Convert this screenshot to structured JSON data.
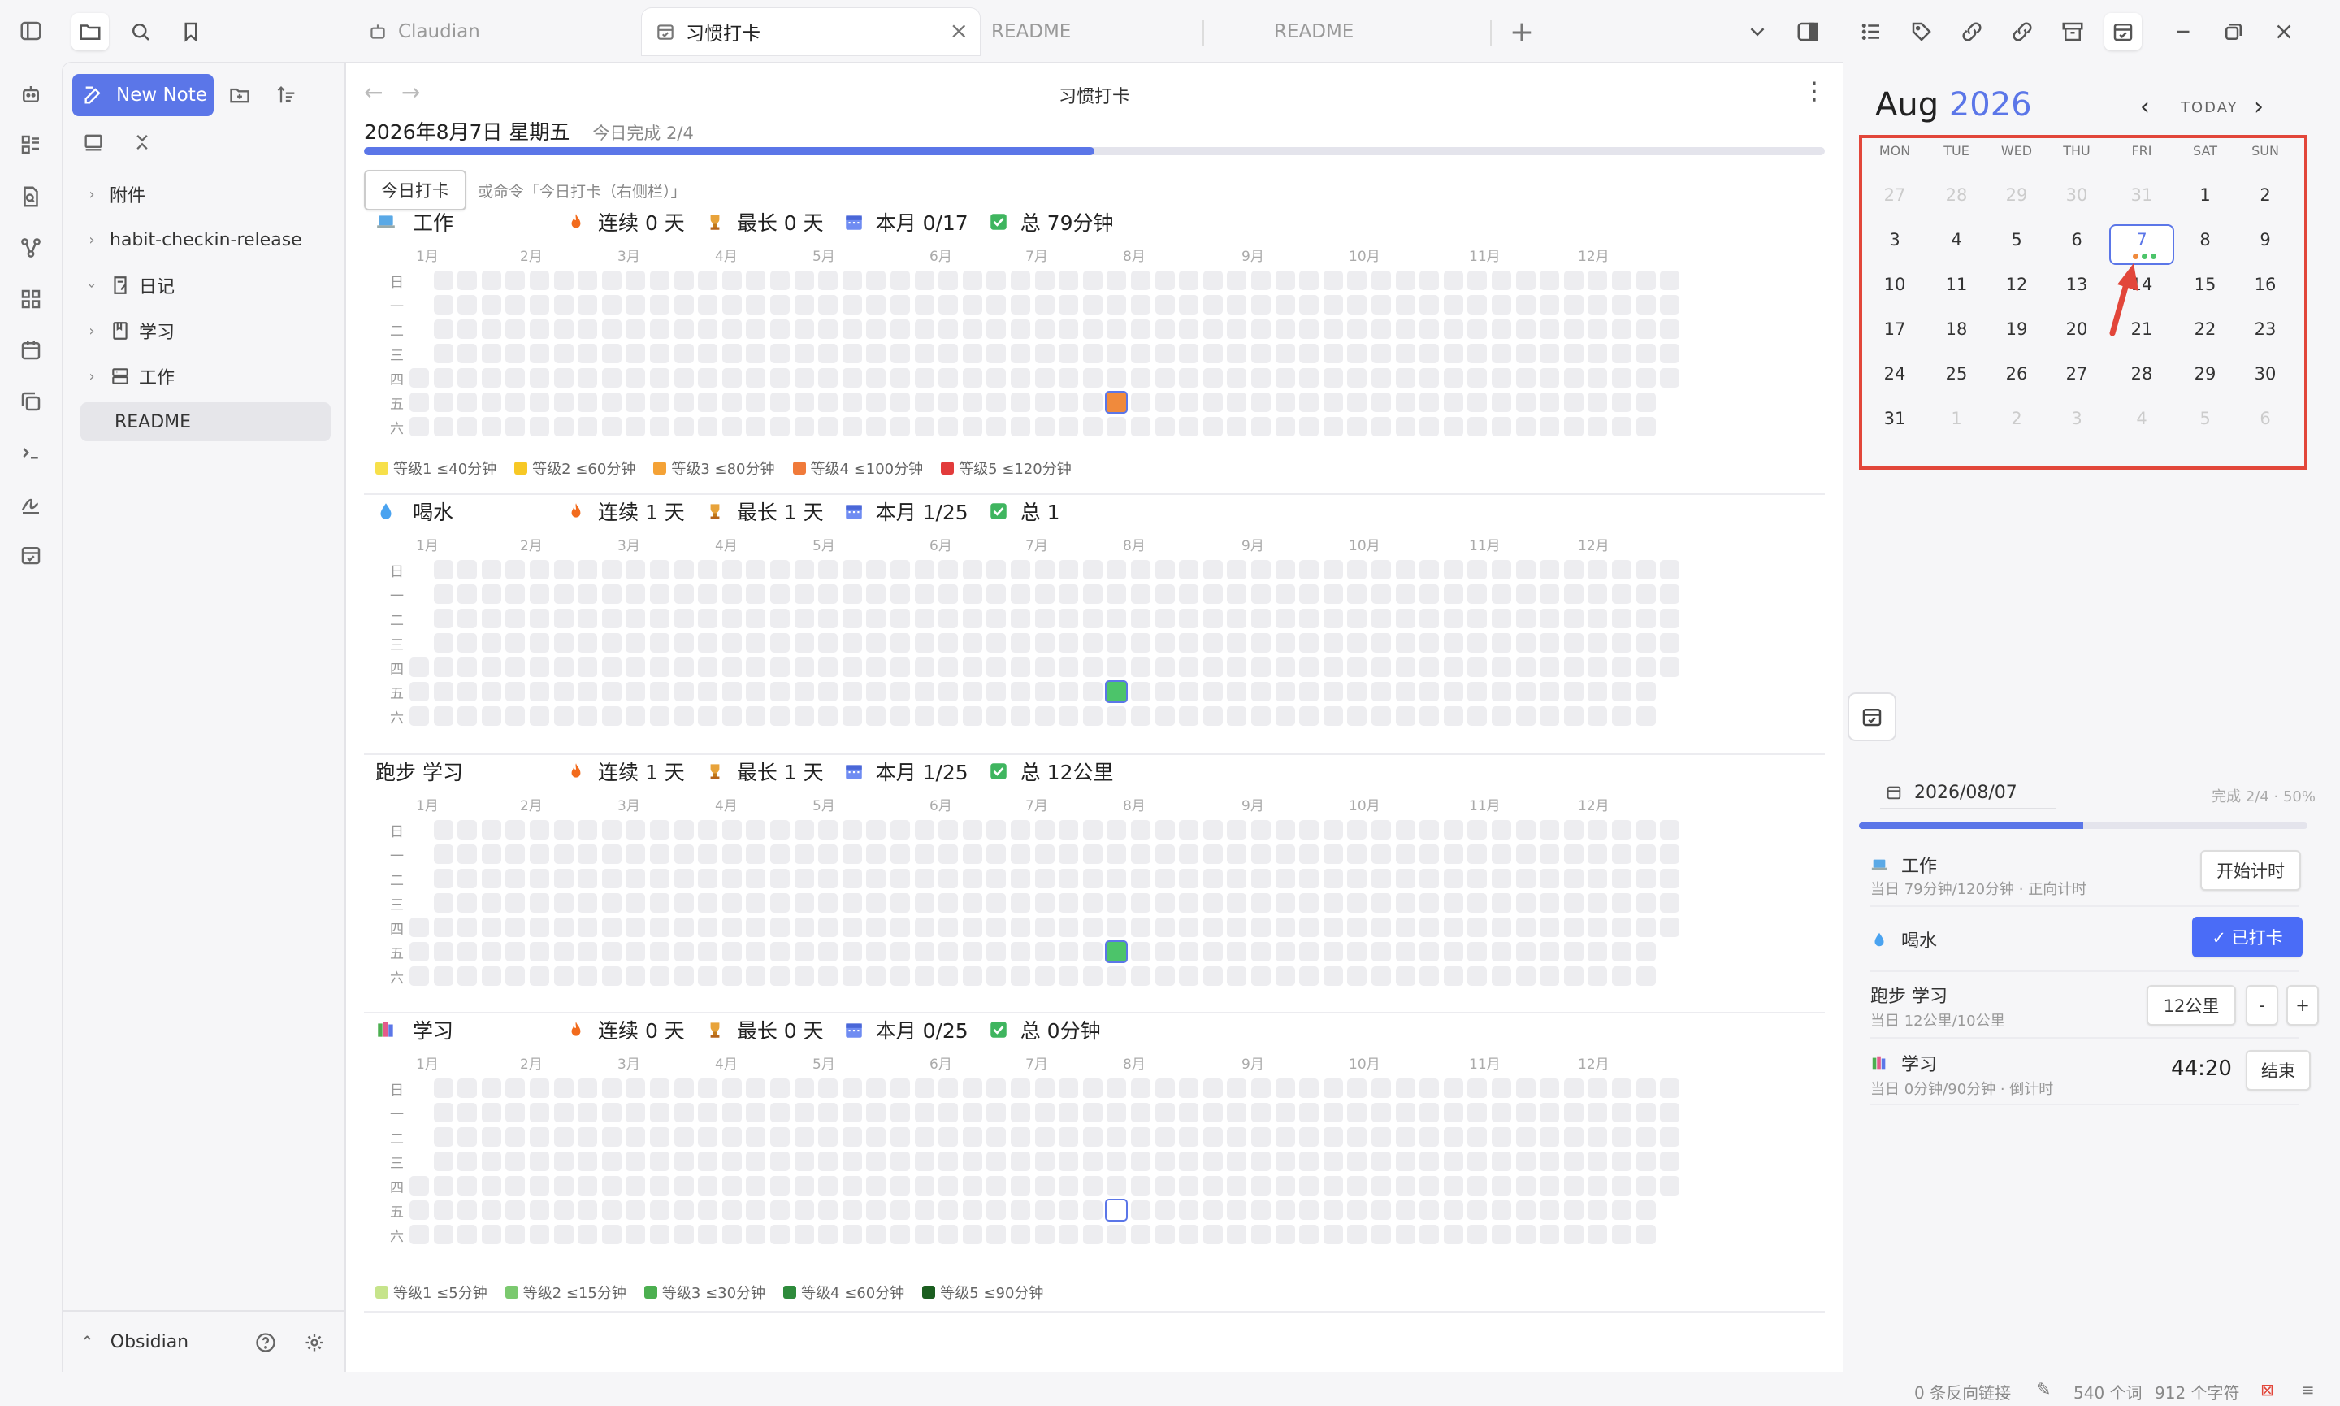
{
  "tabs": [
    {
      "label": "Claudian",
      "active": false
    },
    {
      "label": "习惯打卡",
      "active": true
    },
    {
      "label": "README",
      "active": false
    },
    {
      "label": "README",
      "active": false
    }
  ],
  "sidebar": {
    "new_note": "New Note",
    "items": [
      {
        "label": "附件",
        "type": "folder",
        "expanded": false
      },
      {
        "label": "habit-checkin-release",
        "type": "folder",
        "expanded": false
      },
      {
        "label": "日记",
        "type": "folder",
        "expanded": true
      },
      {
        "label": "学习",
        "type": "folder",
        "expanded": false
      },
      {
        "label": "工作",
        "type": "folder",
        "expanded": false
      },
      {
        "label": "README",
        "type": "file",
        "selected": true
      }
    ],
    "vault_name": "Obsidian"
  },
  "main": {
    "title": "习惯打卡",
    "date_heading": "2026年8月7日  星期五",
    "today_done": "今日完成 2/4",
    "progress": 0.5,
    "checkin_button": "今日打卡",
    "hint": "或命令「今日打卡（右侧栏）」",
    "months": [
      "1月",
      "2月",
      "3月",
      "4月",
      "5月",
      "6月",
      "7月",
      "8月",
      "9月",
      "10月",
      "11月",
      "12月"
    ],
    "weekdays": [
      "日",
      "一",
      "二",
      "三",
      "四",
      "五",
      "六"
    ],
    "habits": [
      {
        "name": "工作",
        "icon": "laptop-icon",
        "streak": "连续 0 天",
        "longest": "最长 0 天",
        "month": "本月 0/17",
        "total": "总 79分钟",
        "today_color": "#f08a3c",
        "legend": [
          {
            "label": "等级1 ≤40分钟",
            "color": "#f7e04a"
          },
          {
            "label": "等级2 ≤60分钟",
            "color": "#f7c825"
          },
          {
            "label": "等级3 ≤80分钟",
            "color": "#f4a236"
          },
          {
            "label": "等级4 ≤100分钟",
            "color": "#f07a3a"
          },
          {
            "label": "等级5 ≤120分钟",
            "color": "#e23b3b"
          }
        ]
      },
      {
        "name": "喝水",
        "icon": "droplet-icon",
        "streak": "连续 1 天",
        "longest": "最长 1 天",
        "month": "本月 1/25",
        "total": "总 1",
        "today_color": "#4cc46a",
        "legend": []
      },
      {
        "name": "跑步 学习",
        "icon": "",
        "streak": "连续 1 天",
        "longest": "最长 1 天",
        "month": "本月 1/25",
        "total": "总 12公里",
        "today_color": "#4cc46a",
        "legend": []
      },
      {
        "name": "学习",
        "icon": "books-icon",
        "streak": "连续 0 天",
        "longest": "最长 0 天",
        "month": "本月 0/25",
        "total": "总 0分钟",
        "today_color": "",
        "legend": [
          {
            "label": "等级1 ≤5分钟",
            "color": "#c6e48b"
          },
          {
            "label": "等级2 ≤15分钟",
            "color": "#7bc96f"
          },
          {
            "label": "等级3 ≤30分钟",
            "color": "#4caf50"
          },
          {
            "label": "等级4 ≤60分钟",
            "color": "#2e8b3c"
          },
          {
            "label": "等级5 ≤90分钟",
            "color": "#1b5e20"
          }
        ]
      }
    ]
  },
  "calendar": {
    "month": "Aug",
    "year": "2026",
    "today_label": "TODAY",
    "dow": [
      "MON",
      "TUE",
      "WED",
      "THU",
      "FRI",
      "SAT",
      "SUN"
    ],
    "weeks": [
      [
        "27",
        "28",
        "29",
        "30",
        "31",
        "1",
        "2"
      ],
      [
        "3",
        "4",
        "5",
        "6",
        "7",
        "8",
        "9"
      ],
      [
        "10",
        "11",
        "12",
        "13",
        "14",
        "15",
        "16"
      ],
      [
        "17",
        "18",
        "19",
        "20",
        "21",
        "22",
        "23"
      ],
      [
        "24",
        "25",
        "26",
        "27",
        "28",
        "29",
        "30"
      ],
      [
        "31",
        "1",
        "2",
        "3",
        "4",
        "5",
        "6"
      ]
    ],
    "selected_day": "7",
    "dot_colors": [
      "#f08a3c",
      "#4cc46a",
      "#4cc46a"
    ]
  },
  "today_panel": {
    "date": "2026/08/07",
    "done": "完成 2/4 · 50%",
    "progress": 0.5,
    "rows": [
      {
        "name": "工作",
        "icon": "laptop-icon",
        "sub": "当日 79分钟/120分钟 · 正向计时",
        "button": "开始计时"
      },
      {
        "name": "喝水",
        "icon": "droplet-icon",
        "sub": "",
        "button": "✓ 已打卡"
      },
      {
        "name": "跑步 学习",
        "icon": "",
        "sub": "当日 12公里/10公里",
        "value": "12公里",
        "minus": "-",
        "plus": "+"
      },
      {
        "name": "学习",
        "icon": "books-icon",
        "sub": "当日 0分钟/90分钟 · 倒计时",
        "timer": "44:20",
        "button": "结束"
      }
    ]
  },
  "status": {
    "backlinks": "0 条反向链接",
    "words": "540 个词",
    "chars": "912 个字符"
  }
}
